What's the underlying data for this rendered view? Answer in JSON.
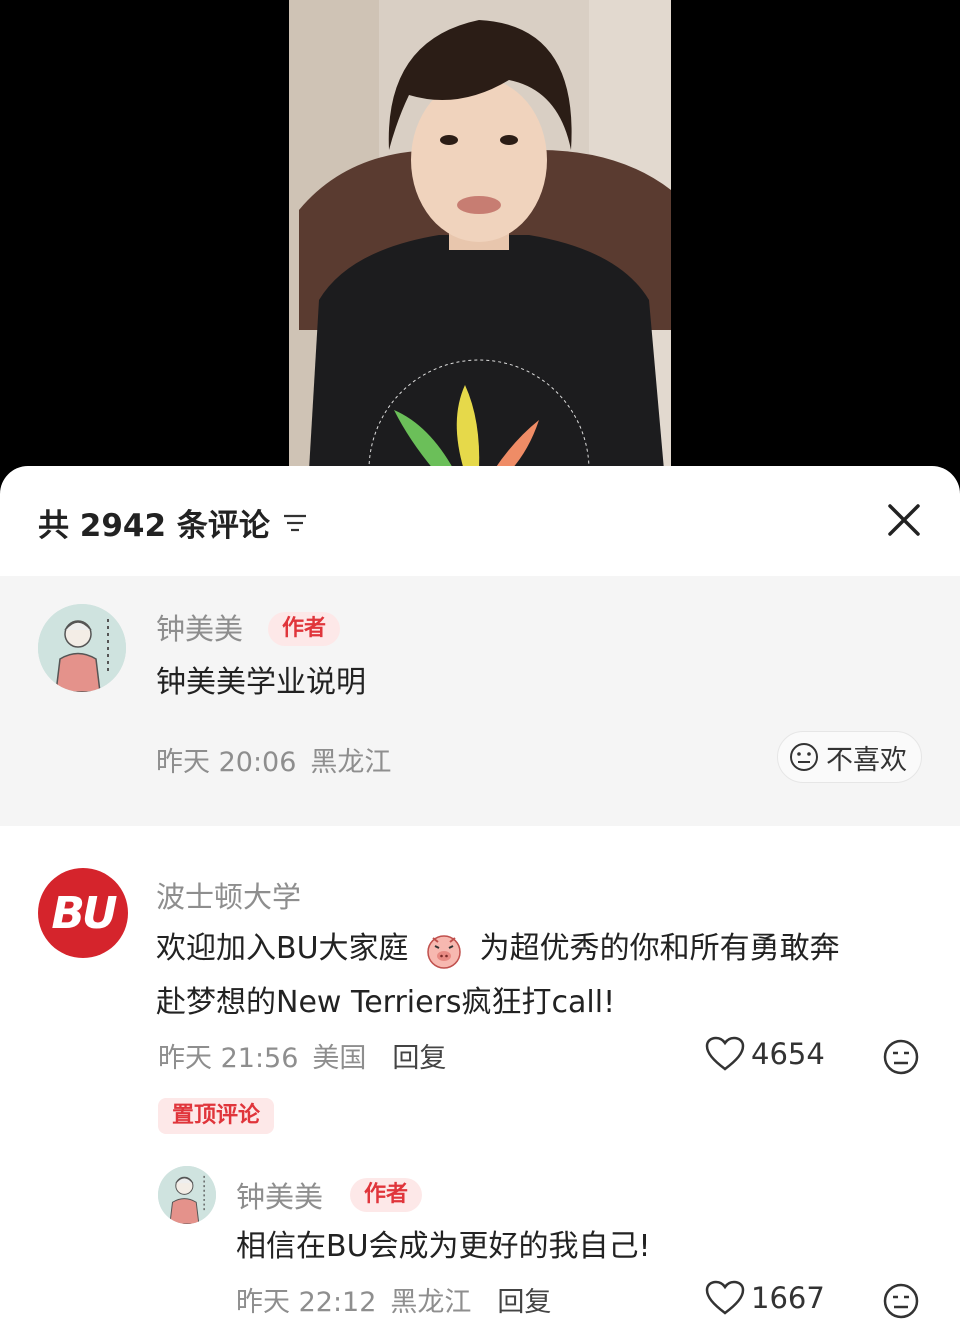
{
  "header": {
    "comment_count_label": "共 2942 条评论",
    "sort_icon": "sort-lines-icon",
    "close_icon": "close-icon"
  },
  "author_comment": {
    "username": "钟美美",
    "tag": "作者",
    "text": "钟美美学业说明",
    "time": "昨天 20:06",
    "location": "黑龙江",
    "dislike_label": "不喜欢"
  },
  "pinned_comment": {
    "avatar_text": "BU",
    "username": "波士顿大学",
    "text_before_emoji": "欢迎加入BU大家庭",
    "emoji": "pig-face-emoji",
    "text_after_emoji": "为超优秀的你和所有勇敢奔",
    "text_line2": "赴梦想的New Terriers疯狂打call!",
    "time": "昨天 21:56",
    "location": "美国",
    "reply_label": "回复",
    "likes": "4654",
    "pinned_label": "置顶评论"
  },
  "reply_comment": {
    "username": "钟美美",
    "tag": "作者",
    "text": "相信在BU会成为更好的我自己!",
    "time": "昨天 22:12",
    "location": "黑龙江",
    "reply_label": "回复",
    "likes": "1667"
  },
  "colors": {
    "accent_red": "#e0353b",
    "tag_bg": "#fde8e8",
    "bu_red": "#d5242c"
  }
}
